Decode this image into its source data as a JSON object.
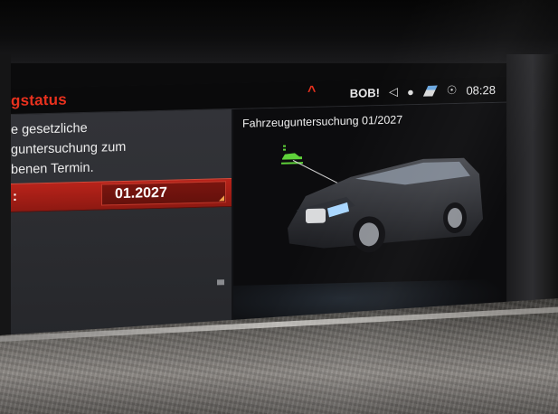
{
  "statusbar": {
    "title": "gstatus",
    "profile": "BOB!",
    "time": "08:28",
    "icons": [
      "caret-up-icon",
      "speaker-icon",
      "microphone-icon",
      "navigation-icon",
      "connectivity-icon"
    ]
  },
  "left_panel": {
    "message_lines": [
      "e gesetzliche",
      "guntersuchung zum",
      "benen Termin."
    ],
    "date_label": ":",
    "date_value": "01.2027"
  },
  "right_panel": {
    "title": "Fahrzeuguntersuchung  01/2027",
    "inspection_icon": "car-inspection-icon",
    "vehicle": "vehicle-image"
  },
  "colors": {
    "accent_red": "#e8311e",
    "selected_row": "#b8231a",
    "inspection_green": "#5fd23a"
  }
}
